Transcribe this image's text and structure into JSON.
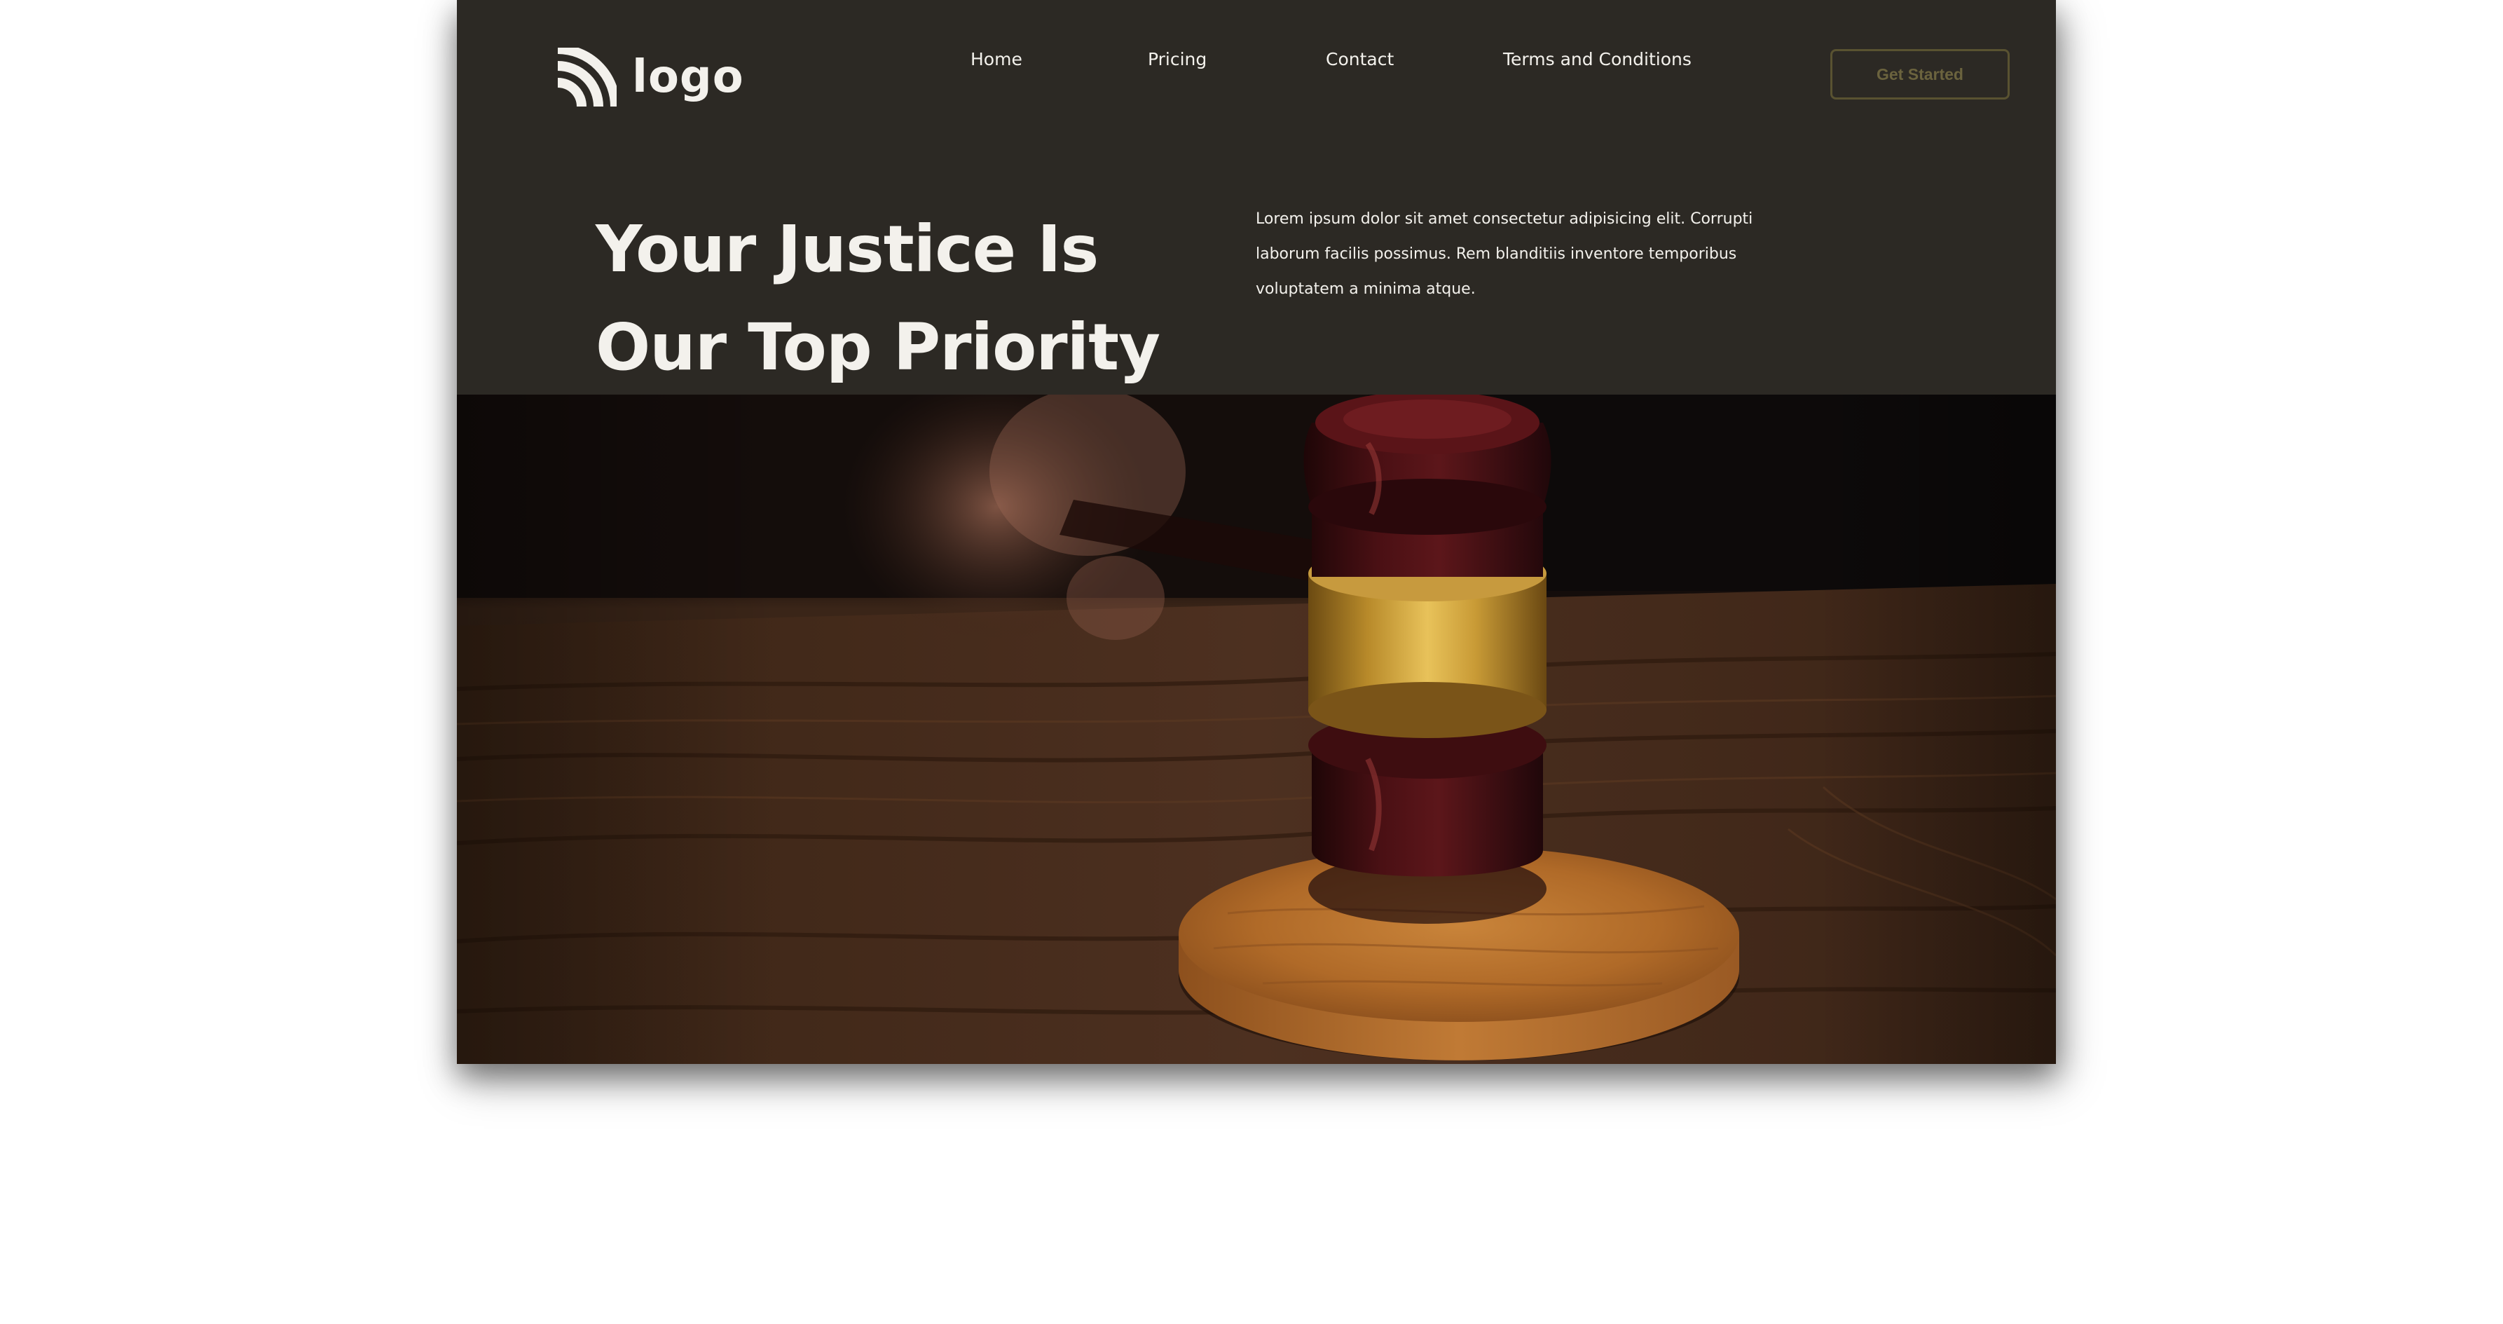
{
  "header": {
    "logo_text": "logo",
    "nav": [
      "Home",
      "Pricing",
      "Contact",
      "Terms and Conditions"
    ],
    "cta_label": "Get Started"
  },
  "hero": {
    "headline_line1": "Your Justice Is",
    "headline_line2": "Our Top Priority",
    "intro": "Lorem ipsum dolor sit amet consectetur adipisicing elit. Corrupti laborum facilis possimus. Rem blanditiis inventore temporibus voluptatem a minima atque."
  },
  "colors": {
    "background": "#2c2924",
    "text": "#f3f1ec",
    "button_border": "#595231",
    "button_text": "#6b633e"
  },
  "icons": {
    "logo": "signal-arcs-icon"
  }
}
